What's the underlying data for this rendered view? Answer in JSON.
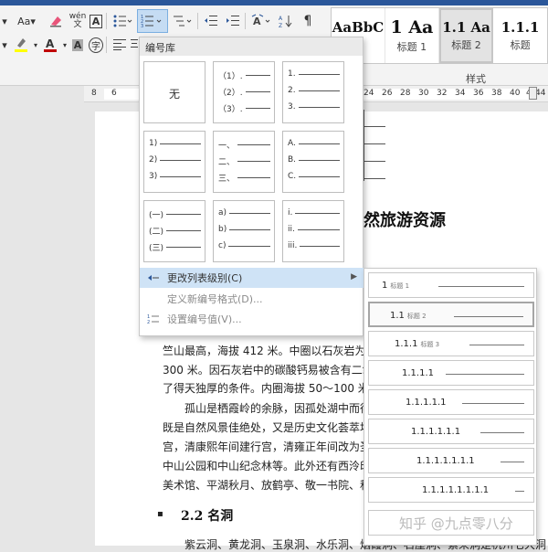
{
  "ribbon": {
    "font_size_label": "Aa",
    "pinyin_label": "wén",
    "styles": [
      {
        "sample": "AaBbC",
        "name": "题",
        "selected": false
      },
      {
        "sample": "1 Aa",
        "name": "标题 1",
        "selected": false
      },
      {
        "sample": "1.1 Aa",
        "name": "标题 2",
        "selected": true
      },
      {
        "sample": "1.1.1",
        "name": "标题",
        "selected": false
      }
    ],
    "styles_group_label": "样式",
    "font_color": "#c00000",
    "highlight_color": "#ffff00"
  },
  "ruler": {
    "left_ticks": [
      "8",
      "6"
    ],
    "right_ticks": [
      "24",
      "26",
      "28",
      "30",
      "32",
      "34",
      "36",
      "38",
      "40",
      "42",
      "44"
    ]
  },
  "numbering_menu": {
    "header": "编号库",
    "cells": [
      {
        "kind": "none",
        "label": "无"
      },
      {
        "kind": "list",
        "items": [
          "（1）.",
          "（2）.",
          "（3）."
        ]
      },
      {
        "kind": "list",
        "items": [
          "1.",
          "2.",
          "3."
        ]
      },
      {
        "kind": "list",
        "items": [
          "1)",
          "2)",
          "3)"
        ]
      },
      {
        "kind": "list",
        "items": [
          "一、",
          "二、",
          "三、"
        ]
      },
      {
        "kind": "list",
        "items": [
          "A.",
          "B.",
          "C."
        ]
      },
      {
        "kind": "list",
        "items": [
          "(一)",
          "(二)",
          "(三)"
        ]
      },
      {
        "kind": "list",
        "items": [
          "a)",
          "b)",
          "c)"
        ]
      },
      {
        "kind": "list",
        "items": [
          "i.",
          "ii.",
          "iii."
        ]
      }
    ],
    "change_level": "更改列表级别(C)",
    "define_new": "定义新编号格式(D)...",
    "set_value": "设置编号值(V)..."
  },
  "level_flyout": {
    "levels": [
      {
        "number": "1",
        "sub": "标题 1",
        "selected": false
      },
      {
        "number": "1.1",
        "sub": "标题 2",
        "selected": true
      },
      {
        "number": "1.1.1",
        "sub": "标题 3",
        "selected": false
      },
      {
        "number": "1.1.1.1",
        "sub": "",
        "selected": false
      },
      {
        "number": "1.1.1.1.1",
        "sub": "",
        "selected": false
      },
      {
        "number": "1.1.1.1.1.1",
        "sub": "",
        "selected": false
      },
      {
        "number": "1.1.1.1.1.1.1",
        "sub": "",
        "selected": false
      },
      {
        "number": "1.1.1.1.1.1.1.1",
        "sub": "",
        "selected": false
      },
      {
        "number": "",
        "sub": "",
        "selected": false
      }
    ]
  },
  "document": {
    "heading_fragment": "然旅游资源",
    "lines": [
      "竺山最高，海拔 412 米。中圈以石灰岩为主，如",
      "300 米。因石灰岩中的碳酸钙易被含有二氧化碳",
      "了得天独厚的条件。内圈海拔 50～100 米，也以",
      "孤山是栖霞岭的余脉，因孤处湖中而得名，",
      "既是自然风景佳绝处，又是历史文化荟萃地，是",
      "宫，清康熙年间建行宫，清雍正年间改为圣因寺",
      "中山公园和中山纪念林等。此外还有西泠印社、",
      "美术馆、平湖秋月、放鹤亭、敬一书院、秋瑾墓"
    ],
    "section_heading": "2.2 名洞",
    "bottom_line": "紫云洞、黄龙洞、玉泉洞、水乐洞、烟霞洞、石屋洞、紫来洞是杭州七大洞"
  },
  "watermark": "知乎 @九点零八分"
}
